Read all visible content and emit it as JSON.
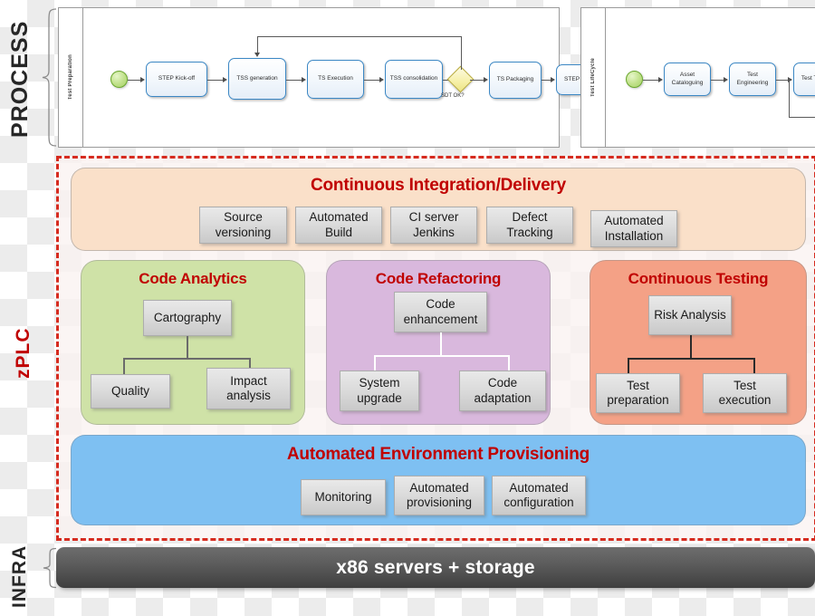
{
  "rails": {
    "process": "PROCESS",
    "zplc": "zPLC",
    "infra": "INFRA"
  },
  "process": {
    "pool_left": {
      "lane": "Test Preparation",
      "start_node": "start-event",
      "end_node": "end-event",
      "gateway_label": "SDT OK?",
      "tasks": [
        "STEP Kick-off",
        "TSS generation",
        "TS Execution",
        "TSS consolidation",
        "TS Packaging",
        "STEP closing"
      ]
    },
    "pool_right": {
      "lane": "Test LifeCycle",
      "start_node": "start-event",
      "tasks": [
        "Asset Cataloguing",
        "Test Engineering",
        "Test Tooling"
      ]
    }
  },
  "zplc": {
    "cicd": {
      "title": "Continuous Integration/Delivery",
      "color": "#fae0c9",
      "items": [
        "Source versioning",
        "Automated Build",
        "CI server Jenkins",
        "Defect Tracking",
        "Automated Installation"
      ]
    },
    "panels": [
      {
        "title": "Code Analytics",
        "color": "#cfe2a7",
        "parent": "Cartography",
        "children": [
          "Quality",
          "Impact analysis"
        ]
      },
      {
        "title": "Code Refactoring",
        "color": "#d9b8dd",
        "parent": "Code enhancement",
        "children": [
          "System upgrade",
          "Code adaptation"
        ]
      },
      {
        "title": "Continuous Testing",
        "color": "#f4a186",
        "parent": "Risk Analysis",
        "children": [
          "Test preparation",
          "Test execution"
        ]
      }
    ],
    "provisioning": {
      "title": "Automated Environment Provisioning",
      "color": "#7ec0f2",
      "items": [
        "Monitoring",
        "Automated provisioning",
        "Automated configuration"
      ]
    },
    "border_color": "#d62b1f",
    "title_color": "#c00000"
  },
  "infra": {
    "label": "x86 servers + storage"
  }
}
